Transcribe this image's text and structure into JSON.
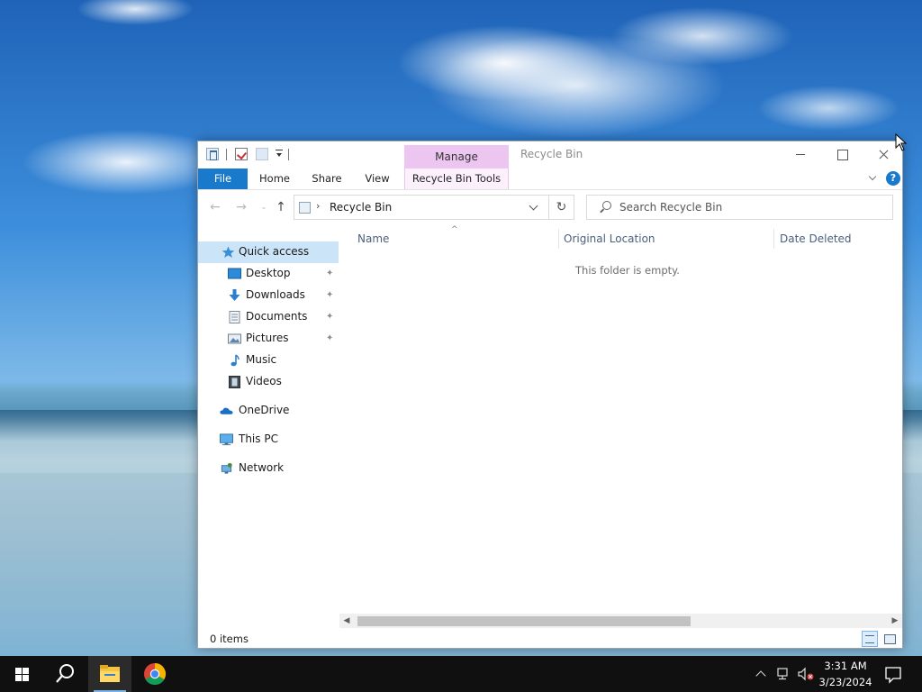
{
  "window": {
    "title": "Recycle Bin",
    "contextual_tab_group": "Manage"
  },
  "ribbon": {
    "tabs": [
      {
        "label": "File"
      },
      {
        "label": "Home"
      },
      {
        "label": "Share"
      },
      {
        "label": "View"
      },
      {
        "label": "Recycle Bin Tools"
      }
    ],
    "help_label": "?"
  },
  "address_bar": {
    "path": "Recycle Bin",
    "separator": "›",
    "refresh_symbol": "↻"
  },
  "search": {
    "placeholder": "Search Recycle Bin",
    "value": ""
  },
  "navigation_buttons": {
    "back": "←",
    "forward": "→",
    "recent": "⌄",
    "up": "↑"
  },
  "nav_pane": {
    "quick_access": "Quick access",
    "pinned": [
      {
        "label": "Desktop",
        "icon": "desktop-icon",
        "pinned": true
      },
      {
        "label": "Downloads",
        "icon": "downloads-icon",
        "pinned": true
      },
      {
        "label": "Documents",
        "icon": "documents-icon",
        "pinned": true
      },
      {
        "label": "Pictures",
        "icon": "pictures-icon",
        "pinned": true
      },
      {
        "label": "Music",
        "icon": "music-icon",
        "pinned": false
      },
      {
        "label": "Videos",
        "icon": "videos-icon",
        "pinned": false
      }
    ],
    "locations": [
      {
        "label": "OneDrive",
        "icon": "onedrive-icon"
      },
      {
        "label": "This PC",
        "icon": "this-pc-icon"
      },
      {
        "label": "Network",
        "icon": "network-icon"
      }
    ],
    "pin_symbol": "📌"
  },
  "content": {
    "columns": [
      "Name",
      "Original Location",
      "Date Deleted"
    ],
    "sort_indicator": "^",
    "empty_message": "This folder is empty."
  },
  "status_bar": {
    "item_count": "0 items"
  },
  "taskbar": {
    "pinned_apps": [
      "file-explorer-icon",
      "chrome-icon"
    ],
    "clock_time": "3:31 AM",
    "clock_date": "3/23/2024"
  },
  "colors": {
    "accent": "#1979ca",
    "manage_tab": "#ecc6f0",
    "selection": "#cce4f7",
    "taskbar": "#101010"
  }
}
